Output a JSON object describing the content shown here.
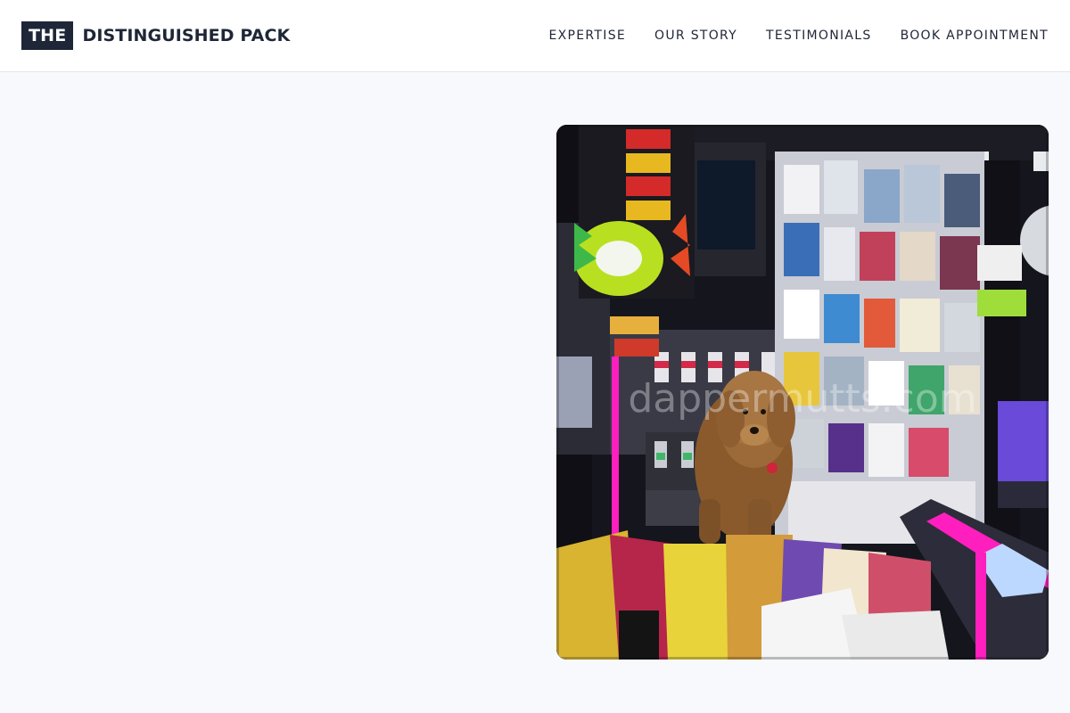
{
  "header": {
    "logo_badge": "THE",
    "logo_text": "DISTINGUISHED PACK",
    "nav": [
      {
        "label": "EXPERTISE"
      },
      {
        "label": "OUR STORY"
      },
      {
        "label": "TESTIMONIALS"
      },
      {
        "label": "BOOK APPOINTMENT"
      }
    ]
  },
  "hero": {
    "image_alt": "Poodle sitting at a brightly lit newsstand",
    "watermark": "dappermutts.com"
  },
  "colors": {
    "page_bg": "#f8f9fd",
    "header_bg": "#ffffff",
    "brand_dark": "#1e2637",
    "neon_pink": "#ff1fbf"
  }
}
